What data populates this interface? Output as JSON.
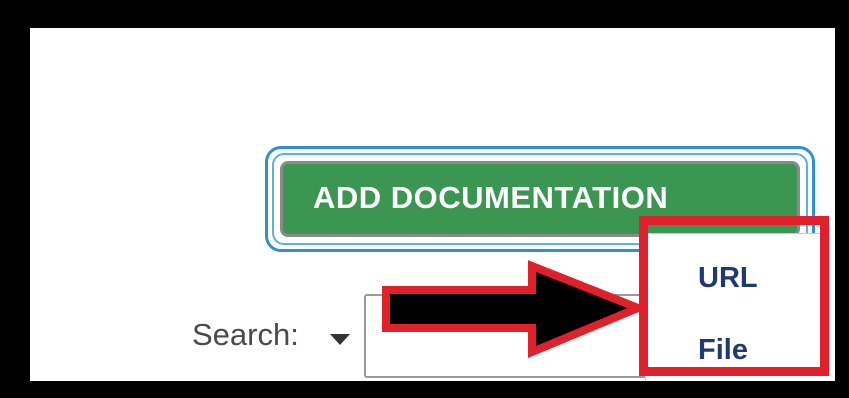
{
  "toolbar": {
    "add_button_label": "ADD DOCUMENTATION"
  },
  "search": {
    "label": "Search:",
    "value": "",
    "placeholder": ""
  },
  "dropdown": {
    "items": [
      {
        "label": "URL"
      },
      {
        "label": "File"
      }
    ]
  },
  "colors": {
    "button_green": "#3a9650",
    "focus_ring": "#2f8fd8",
    "annotation_red": "#e0202a",
    "menu_text": "#1f3a6e"
  },
  "icons": {
    "search_caret": "caret-down-icon",
    "annotation_arrow": "arrow-right-icon"
  }
}
